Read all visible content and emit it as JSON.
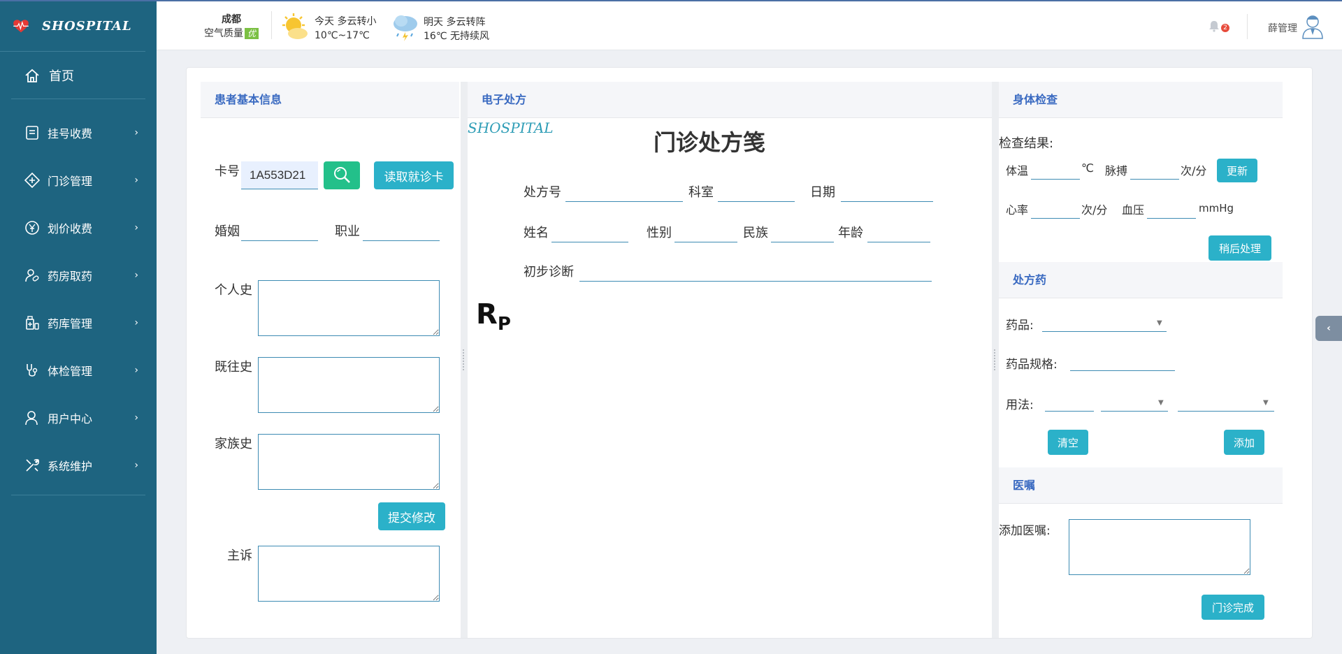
{
  "app": {
    "name": "SHOSPITAL"
  },
  "sidebar": {
    "home_label": "首页",
    "items": [
      {
        "label": "挂号收费",
        "icon": "register-icon"
      },
      {
        "label": "门诊管理",
        "icon": "clinic-icon"
      },
      {
        "label": "划价收费",
        "icon": "pricing-icon"
      },
      {
        "label": "药房取药",
        "icon": "pharmacy-icon"
      },
      {
        "label": "药库管理",
        "icon": "drug-store-icon"
      },
      {
        "label": "体检管理",
        "icon": "stethoscope-icon"
      },
      {
        "label": "用户中心",
        "icon": "user-icon"
      },
      {
        "label": "系统维护",
        "icon": "tools-icon"
      }
    ]
  },
  "header": {
    "city": "成都",
    "air_quality_label": "空气质量",
    "air_quality_value": "优",
    "today": {
      "line1": "今天  多云转小",
      "line2": "10℃~17℃"
    },
    "tomorrow": {
      "line1": "明天  多云转阵",
      "line2": "16℃ 无持续风"
    },
    "notification_count": "2",
    "user_name": "薛管理"
  },
  "patient_info": {
    "title": "患者基本信息",
    "card_label": "卡号",
    "card_value": "1A553D21",
    "read_card_label": "读取就诊卡",
    "marital_label": "婚姻",
    "job_label": "职业",
    "personal_history_label": "个人史",
    "past_history_label": "既往史",
    "family_history_label": "家族史",
    "submit_label": "提交修改",
    "complaint_label": "主诉"
  },
  "prescription": {
    "title": "电子处方",
    "brand": "SHOSPITAL",
    "heading": "门诊处方笺",
    "rx_no_label": "处方号",
    "dept_label": "科室",
    "date_label": "日期",
    "name_label": "姓名",
    "gender_label": "性别",
    "ethnic_label": "民族",
    "age_label": "年龄",
    "diagnosis_label": "初步诊断",
    "rx_symbol_main": "R",
    "rx_symbol_sub": "P"
  },
  "exam": {
    "title": "身体检查",
    "result_label": "检查结果:",
    "temp_label": "体温",
    "temp_unit": "℃",
    "pulse_label": "脉搏",
    "pulse_unit": "次/分",
    "update_label": "更新",
    "heart_label": "心率",
    "heart_unit": "次/分",
    "bp_label": "血压",
    "bp_unit": "mmHg",
    "later_label": "稍后处理"
  },
  "medicine": {
    "title": "处方药",
    "drug_label": "药品:",
    "spec_label": "药品规格:",
    "usage_label": "用法:",
    "clear_label": "清空",
    "add_label": "添加"
  },
  "advice": {
    "title": "医嘱",
    "add_label": "添加医嘱:",
    "finish_label": "门诊完成"
  },
  "colors": {
    "sidebar": "#1e6480",
    "accent": "#2bb1c9",
    "search": "#23c08a",
    "header_text": "#3a6ac1"
  }
}
